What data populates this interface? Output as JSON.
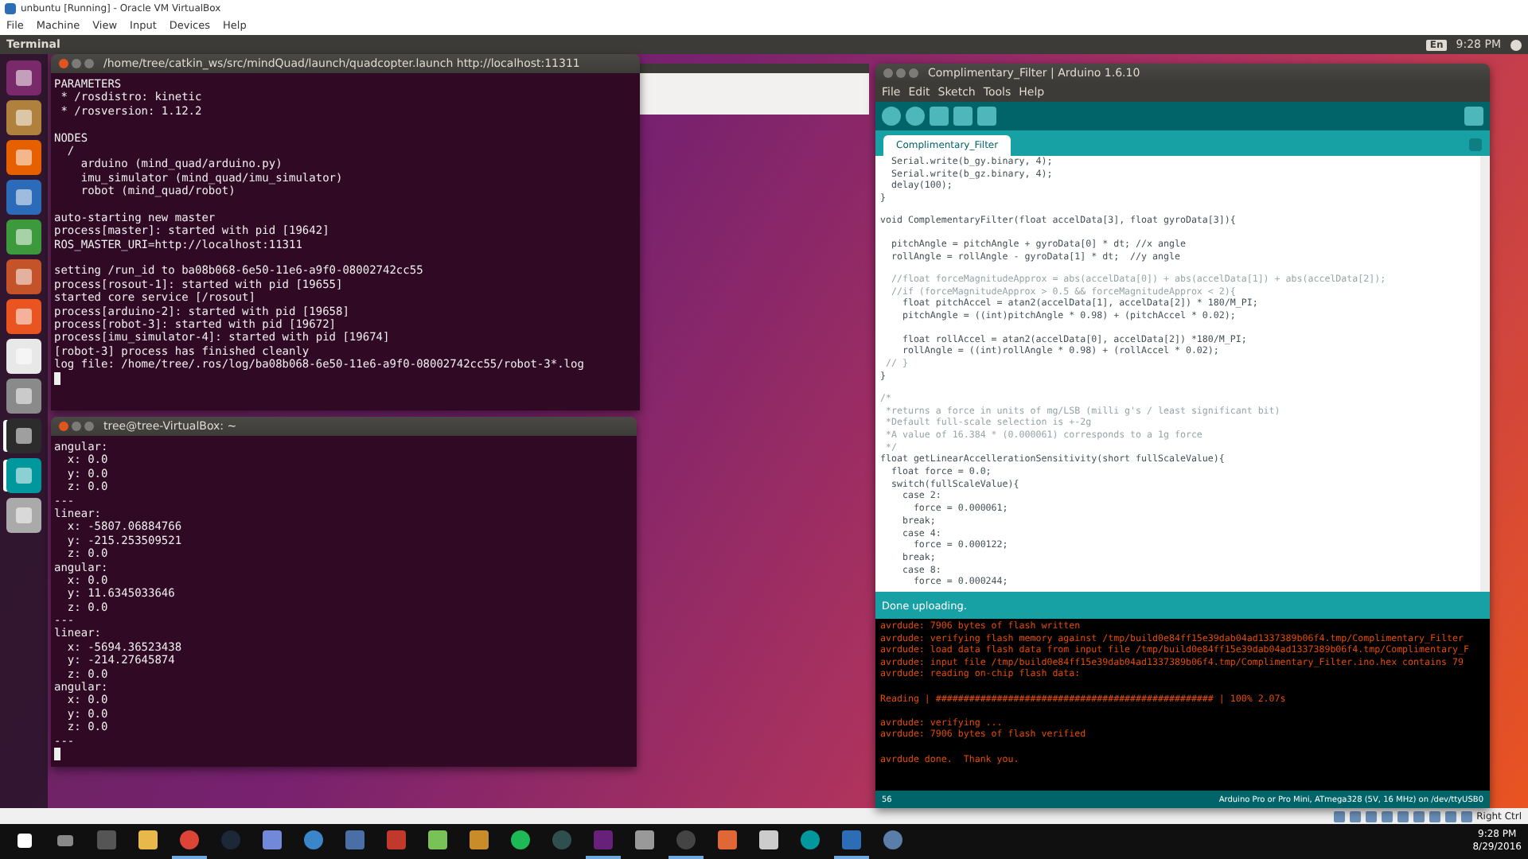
{
  "host_window": {
    "title": "unbuntu [Running] - Oracle VM VirtualBox",
    "menu": [
      "File",
      "Machine",
      "View",
      "Input",
      "Devices",
      "Help"
    ]
  },
  "top_panel": {
    "app_title": "Terminal",
    "keyboard": "En",
    "time": "9:28 PM"
  },
  "launcher": {
    "items": [
      {
        "kind": "dash",
        "active": false
      },
      {
        "kind": "files",
        "active": false
      },
      {
        "kind": "browser",
        "active": false
      },
      {
        "kind": "writer",
        "active": false
      },
      {
        "kind": "calc",
        "active": false
      },
      {
        "kind": "impress",
        "active": false
      },
      {
        "kind": "store",
        "active": false
      },
      {
        "kind": "amazon",
        "active": false
      },
      {
        "kind": "settings",
        "active": false
      },
      {
        "kind": "terminal",
        "active": true
      },
      {
        "kind": "arduino",
        "active": true
      },
      {
        "kind": "trash",
        "active": false
      }
    ]
  },
  "ros_terminal": {
    "title": "/home/tree/catkin_ws/src/mindQuad/launch/quadcopter.launch http://localhost:11311",
    "blocks": [
      [
        "PARAMETERS",
        " * /rosdistro: kinetic",
        " * /rosversion: 1.12.2"
      ],
      [
        "NODES",
        "  /",
        "    arduino (mind_quad/arduino.py)",
        "    imu_simulator (mind_quad/imu_simulator)",
        "    robot (mind_quad/robot)"
      ],
      [
        "auto-starting new master",
        "process[master]: started with pid [19642]",
        "ROS_MASTER_URI=http://localhost:11311"
      ],
      [
        "setting /run_id to ba08b068-6e50-11e6-a9f0-08002742cc55",
        "process[rosout-1]: started with pid [19655]",
        "started core service [/rosout]",
        "process[arduino-2]: started with pid [19658]",
        "process[robot-3]: started with pid [19672]",
        "process[imu_simulator-4]: started with pid [19674]",
        "[robot-3] process has finished cleanly",
        "log file: /home/tree/.ros/log/ba08b068-6e50-11e6-a9f0-08002742cc55/robot-3*.log"
      ]
    ]
  },
  "tree_terminal": {
    "title": "tree@tree-VirtualBox: ~",
    "blocks": [
      [
        "angular:",
        "  x: 0.0",
        "  y: 0.0",
        "  z: 0.0",
        "---",
        "linear:",
        "  x: -5807.06884766",
        "  y: -215.253509521",
        "  z: 0.0",
        "angular:",
        "  x: 0.0",
        "  y: 11.6345033646",
        "  z: 0.0",
        "---",
        "linear:",
        "  x: -5694.36523438",
        "  y: -214.27645874",
        "  z: 0.0",
        "angular:",
        "  x: 0.0",
        "  y: 0.0",
        "  z: 0.0",
        "---"
      ]
    ]
  },
  "arduino": {
    "title": "Complimentary_Filter | Arduino 1.6.10",
    "menu": [
      "File",
      "Edit",
      "Sketch",
      "Tools",
      "Help"
    ],
    "tab": "Complimentary_Filter",
    "code_lines": [
      {
        "kind": "code",
        "text": "  Serial.write(b_gy.binary, 4);"
      },
      {
        "kind": "code",
        "text": "  Serial.write(b_gz.binary, 4);"
      },
      {
        "kind": "code",
        "text": "  delay(100);"
      },
      {
        "kind": "code",
        "text": "}"
      },
      {
        "kind": "blank"
      },
      {
        "kind": "code",
        "text": "void ComplementaryFilter(float accelData[3], float gyroData[3]){"
      },
      {
        "kind": "blank"
      },
      {
        "kind": "code",
        "text": "  pitchAngle = pitchAngle + gyroData[0] * dt; //x angle"
      },
      {
        "kind": "code",
        "text": "  rollAngle = rollAngle - gyroData[1] * dt;  //y angle"
      },
      {
        "kind": "blank"
      },
      {
        "kind": "comment",
        "text": "  //float forceMagnitudeApprox = abs(accelData[0]) + abs(accelData[1]) + abs(accelData[2]);"
      },
      {
        "kind": "comment",
        "text": "  //if (forceMagnitudeApprox > 0.5 && forceMagnitudeApprox < 2){"
      },
      {
        "kind": "code",
        "text": "    float pitchAccel = atan2(accelData[1], accelData[2]) * 180/M_PI;"
      },
      {
        "kind": "code",
        "text": "    pitchAngle = ((int)pitchAngle * 0.98) + (pitchAccel * 0.02);"
      },
      {
        "kind": "blank"
      },
      {
        "kind": "code",
        "text": "    float rollAccel = atan2(accelData[0], accelData[2]) *180/M_PI;"
      },
      {
        "kind": "code",
        "text": "    rollAngle = ((int)rollAngle * 0.98) + (rollAccel * 0.02);"
      },
      {
        "kind": "comment",
        "text": " // }"
      },
      {
        "kind": "code",
        "text": "}"
      },
      {
        "kind": "blank"
      },
      {
        "kind": "comment",
        "text": "/*"
      },
      {
        "kind": "comment",
        "text": " *returns a force in units of mg/LSB (milli g's / least significant bit)"
      },
      {
        "kind": "comment",
        "text": " *Default full-scale selection is +-2g"
      },
      {
        "kind": "comment",
        "text": " *A value of 16.384 * (0.000061) corresponds to a 1g force"
      },
      {
        "kind": "comment",
        "text": " */"
      },
      {
        "kind": "code",
        "text": "float getLinearAccellerationSensitivity(short fullScaleValue){"
      },
      {
        "kind": "code",
        "text": "  float force = 0.0;"
      },
      {
        "kind": "code",
        "text": "  switch(fullScaleValue){"
      },
      {
        "kind": "code",
        "text": "    case 2:"
      },
      {
        "kind": "code",
        "text": "      force = 0.000061;"
      },
      {
        "kind": "code",
        "text": "    break;"
      },
      {
        "kind": "code",
        "text": "    case 4:"
      },
      {
        "kind": "code",
        "text": "      force = 0.000122;"
      },
      {
        "kind": "code",
        "text": "    break;"
      },
      {
        "kind": "code",
        "text": "    case 8:"
      },
      {
        "kind": "code",
        "text": "      force = 0.000244;"
      }
    ],
    "status": "Done uploading.",
    "console_blocks": [
      [
        "avrdude: 7906 bytes of flash written",
        "avrdude: verifying flash memory against /tmp/build0e84ff15e39dab04ad1337389b06f4.tmp/Complimentary_Filter",
        "avrdude: load data flash data from input file /tmp/build0e84ff15e39dab04ad1337389b06f4.tmp/Complimentary_F",
        "avrdude: input file /tmp/build0e84ff15e39dab04ad1337389b06f4.tmp/Complimentary_Filter.ino.hex contains 79",
        "avrdude: reading on-chip flash data:"
      ],
      [
        "Reading | ################################################## | 100% 2.07s"
      ],
      [
        "avrdude: verifying ...",
        "avrdude: 7906 bytes of flash verified"
      ],
      [
        "avrdude done.  Thank you."
      ]
    ],
    "line_number": "56",
    "board": "Arduino Pro or Pro Mini, ATmega328 (5V, 16 MHz) on /dev/ttyUSB0"
  },
  "host_status": {
    "host_key": "Right Ctrl"
  },
  "taskbar": {
    "apps": [
      {
        "kind": "terminal",
        "running": false
      },
      {
        "kind": "folder",
        "running": false
      },
      {
        "kind": "chrome",
        "running": true
      },
      {
        "kind": "steam",
        "running": false
      },
      {
        "kind": "chat",
        "running": false
      },
      {
        "kind": "globe",
        "running": false
      },
      {
        "kind": "bubble",
        "running": false
      },
      {
        "kind": "game",
        "running": false
      },
      {
        "kind": "android",
        "running": false
      },
      {
        "kind": "letter",
        "running": false
      },
      {
        "kind": "music",
        "running": false
      },
      {
        "kind": "ring",
        "running": false
      },
      {
        "kind": "vs",
        "running": true
      },
      {
        "kind": "tools",
        "running": false
      },
      {
        "kind": "aperture",
        "running": true
      },
      {
        "kind": "matlab",
        "running": false
      },
      {
        "kind": "clapper",
        "running": false
      },
      {
        "kind": "arduino",
        "running": false
      },
      {
        "kind": "vbox",
        "running": true
      },
      {
        "kind": "disc",
        "running": false
      }
    ],
    "time": "9:28 PM",
    "date": "8/29/2016"
  }
}
